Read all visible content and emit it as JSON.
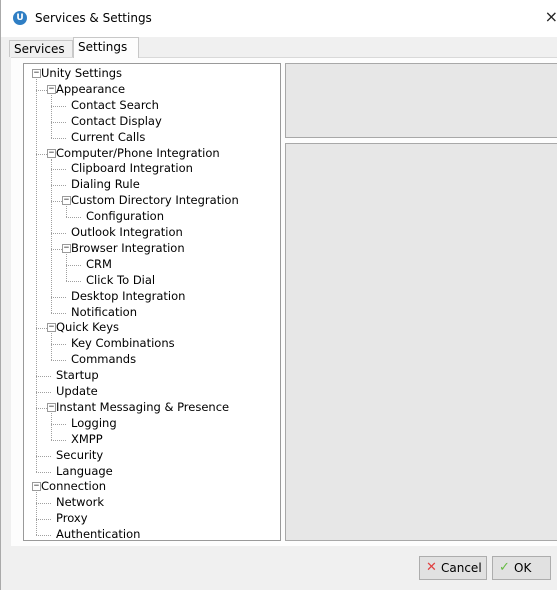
{
  "window": {
    "title": "Services & Settings",
    "app_icon_letter": "U",
    "close_glyph": "×"
  },
  "tabs": [
    {
      "label": "Services",
      "selected": false
    },
    {
      "label": "Settings",
      "selected": true
    }
  ],
  "tree": [
    {
      "label": "Unity Settings",
      "depth": 0,
      "expanded": true
    },
    {
      "label": "Appearance",
      "depth": 1,
      "expanded": true
    },
    {
      "label": "Contact Search",
      "depth": 2
    },
    {
      "label": "Contact Display",
      "depth": 2
    },
    {
      "label": "Current Calls",
      "depth": 2
    },
    {
      "label": "Computer/Phone Integration",
      "depth": 1,
      "expanded": true
    },
    {
      "label": "Clipboard Integration",
      "depth": 2
    },
    {
      "label": "Dialing Rule",
      "depth": 2
    },
    {
      "label": "Custom Directory Integration",
      "depth": 2,
      "expanded": true
    },
    {
      "label": "Configuration",
      "depth": 3
    },
    {
      "label": "Outlook Integration",
      "depth": 2
    },
    {
      "label": "Browser Integration",
      "depth": 2,
      "expanded": true
    },
    {
      "label": "CRM",
      "depth": 3
    },
    {
      "label": "Click To Dial",
      "depth": 3
    },
    {
      "label": "Desktop Integration",
      "depth": 2
    },
    {
      "label": "Notification",
      "depth": 2
    },
    {
      "label": "Quick Keys",
      "depth": 1,
      "expanded": true
    },
    {
      "label": "Key Combinations",
      "depth": 2
    },
    {
      "label": "Commands",
      "depth": 2
    },
    {
      "label": "Startup",
      "depth": 1
    },
    {
      "label": "Update",
      "depth": 1
    },
    {
      "label": "Instant Messaging & Presence",
      "depth": 1,
      "expanded": true
    },
    {
      "label": "Logging",
      "depth": 2
    },
    {
      "label": "XMPP",
      "depth": 2
    },
    {
      "label": "Security",
      "depth": 1
    },
    {
      "label": "Language",
      "depth": 1
    },
    {
      "label": "Connection",
      "depth": 0,
      "expanded": true
    },
    {
      "label": "Network",
      "depth": 1
    },
    {
      "label": "Proxy",
      "depth": 1
    },
    {
      "label": "Authentication",
      "depth": 1
    }
  ],
  "buttons": {
    "cancel": {
      "label": "Cancel",
      "icon": "x-icon",
      "icon_color": "#e04040"
    },
    "ok": {
      "label": "OK",
      "icon": "check-icon",
      "icon_color": "#66bb44"
    }
  },
  "colors": {
    "app_icon": "#2f7ec4",
    "panel_background": "#e7e7e7",
    "window_background": "#f0f0f0"
  }
}
